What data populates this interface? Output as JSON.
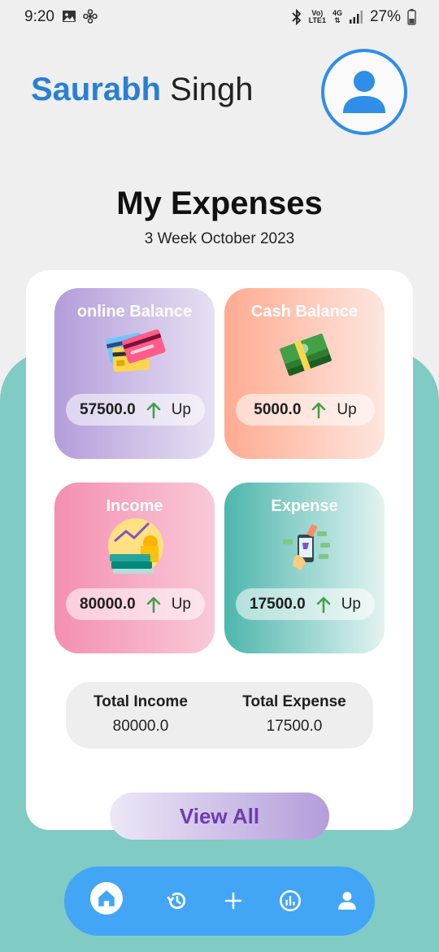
{
  "status_bar": {
    "time": "9:20",
    "network_top": "Vo)",
    "network_bottom": "LTE1",
    "network_type": "4G",
    "battery": "27%"
  },
  "header": {
    "first_name": "Saurabh",
    "last_name": "Singh",
    "avatar_icon": "person-icon"
  },
  "page": {
    "title": "My Expenses",
    "subtitle": "3 Week October 2023"
  },
  "tiles": [
    {
      "title": "online Balance",
      "value": "57500.0",
      "trend": "Up",
      "image": "credit-cards-illustration"
    },
    {
      "title": "Cash Balance",
      "value": "5000.0",
      "trend": "Up",
      "image": "cash-stack-illustration"
    },
    {
      "title": "Income",
      "value": "80000.0",
      "trend": "Up",
      "image": "coins-growth-illustration"
    },
    {
      "title": "Expense",
      "value": "17500.0",
      "trend": "Up",
      "image": "mobile-shopping-illustration"
    }
  ],
  "totals": {
    "income_label": "Total Income",
    "income_value": "80000.0",
    "expense_label": "Total Expense",
    "expense_value": "17500.0"
  },
  "view_all_label": "View All",
  "nav": [
    "home-icon",
    "history-icon",
    "plus-icon",
    "chart-icon",
    "profile-icon"
  ],
  "colors": {
    "accent_blue": "#2a7fd4",
    "nav_blue": "#42a5f5",
    "teal": "#80cbc4",
    "trend_green": "#43a047",
    "view_all_text": "#6f3bb3"
  }
}
